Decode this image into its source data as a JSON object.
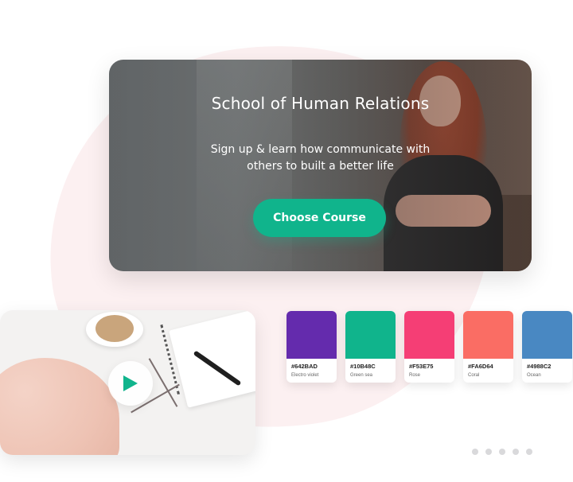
{
  "hero": {
    "title": "School of Human Relations",
    "subtitle": "Sign up & learn how communicate with others to built a better life",
    "cta_label": "Choose Course"
  },
  "video": {
    "play_icon": "play-icon",
    "accent": "#10B48C"
  },
  "swatches": [
    {
      "hex": "#642BAD",
      "name": "Electro violet",
      "color": "#642BAD"
    },
    {
      "hex": "#10B48C",
      "name": "Green sea",
      "color": "#10B48C"
    },
    {
      "hex": "#F53E75",
      "name": "Rose",
      "color": "#F53E75"
    },
    {
      "hex": "#FA6D64",
      "name": "Coral",
      "color": "#FA6D64"
    },
    {
      "hex": "#4988C2",
      "name": "Ocean",
      "color": "#4988C2"
    }
  ],
  "pagination": {
    "count": 5
  }
}
